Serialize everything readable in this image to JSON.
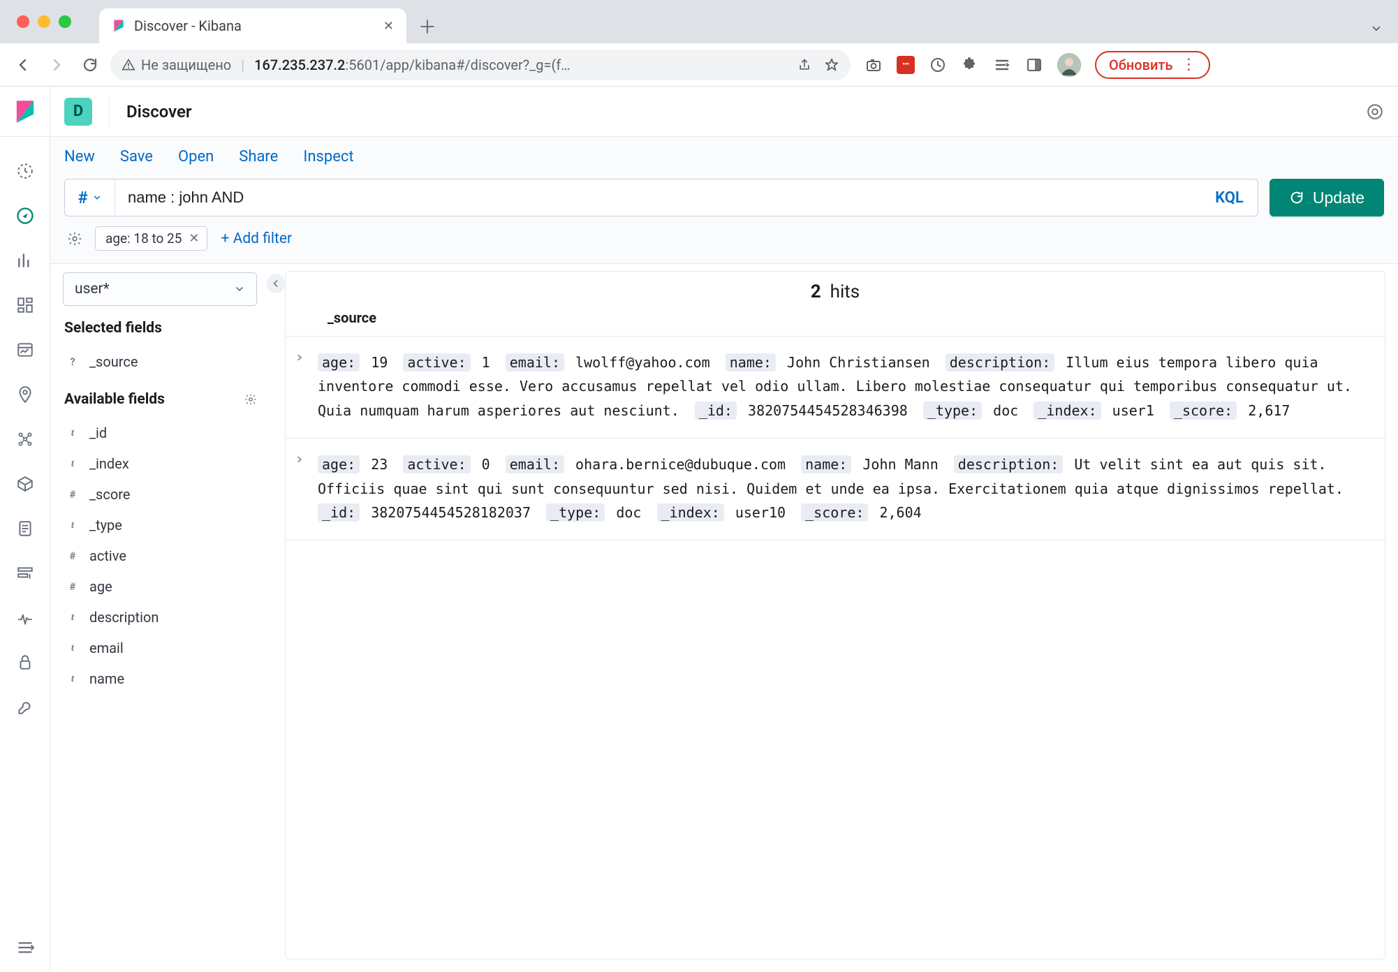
{
  "browser": {
    "tab_title": "Discover - Kibana",
    "insecure_label": "Не защищено",
    "url_host": "167.235.237.2",
    "url_path": ":5601/app/kibana#/discover?_g=(f…",
    "update_label": "Обновить"
  },
  "header": {
    "space_initial": "D",
    "title": "Discover"
  },
  "submenu": {
    "new": "New",
    "save": "Save",
    "open": "Open",
    "share": "Share",
    "inspect": "Inspect"
  },
  "query": {
    "prefix_symbol": "#",
    "value": "name : john AND",
    "lang_label": "KQL",
    "update_label": "Update"
  },
  "filters": {
    "pill_label": "age: 18 to 25",
    "add_label": "+ Add filter"
  },
  "index_pattern": "user*",
  "fields": {
    "selected_title": "Selected fields",
    "available_title": "Available fields",
    "selected": [
      {
        "type": "q",
        "name": "_source"
      }
    ],
    "available": [
      {
        "type": "t",
        "name": "_id"
      },
      {
        "type": "t",
        "name": "_index"
      },
      {
        "type": "h",
        "name": "_score"
      },
      {
        "type": "t",
        "name": "_type"
      },
      {
        "type": "h",
        "name": "active"
      },
      {
        "type": "h",
        "name": "age"
      },
      {
        "type": "t",
        "name": "description"
      },
      {
        "type": "t",
        "name": "email"
      },
      {
        "type": "t",
        "name": "name"
      }
    ]
  },
  "results": {
    "hits_count": "2",
    "hits_label": "hits",
    "column": "_source",
    "docs": [
      {
        "fields": [
          {
            "k": "age:",
            "v": "19"
          },
          {
            "k": "active:",
            "v": "1"
          },
          {
            "k": "email:",
            "v": "lwolff@yahoo.com"
          },
          {
            "k": "name:",
            "v": "John Christiansen"
          },
          {
            "k": "description:",
            "v": "Illum eius tempora libero quia inventore commodi esse. Vero accusamus repellat vel odio ullam. Libero molestiae consequatur qui temporibus consequatur ut. Quia numquam harum asperiores aut nesciunt."
          },
          {
            "k": "_id:",
            "v": "3820754454528346398"
          },
          {
            "k": "_type:",
            "v": "doc"
          },
          {
            "k": "_index:",
            "v": "user1"
          },
          {
            "k": "_score:",
            "v": "2,617"
          }
        ]
      },
      {
        "fields": [
          {
            "k": "age:",
            "v": "23"
          },
          {
            "k": "active:",
            "v": "0"
          },
          {
            "k": "email:",
            "v": "ohara.bernice@dubuque.com"
          },
          {
            "k": "name:",
            "v": "John Mann"
          },
          {
            "k": "description:",
            "v": "Ut velit sint ea aut quis sit. Officiis quae sint qui sunt consequuntur sed nisi. Quidem et unde ea ipsa. Exercitationem quia atque dignissimos repellat."
          },
          {
            "k": "_id:",
            "v": "3820754454528182037"
          },
          {
            "k": "_type:",
            "v": "doc"
          },
          {
            "k": "_index:",
            "v": "user10"
          },
          {
            "k": "_score:",
            "v": "2,604"
          }
        ]
      }
    ]
  }
}
